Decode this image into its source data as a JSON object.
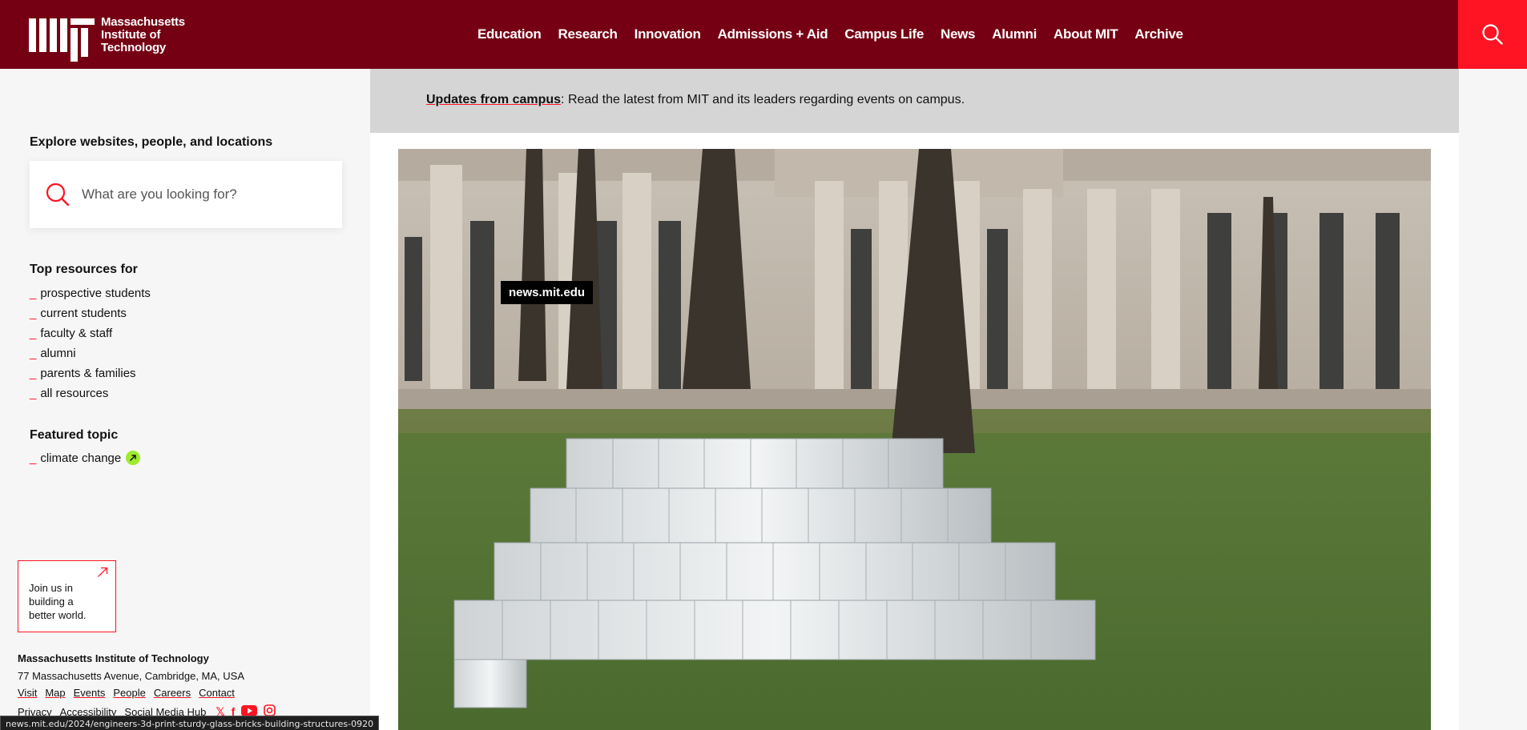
{
  "header": {
    "logo_lines": [
      "Massachusetts",
      "Institute of",
      "Technology"
    ],
    "nav": [
      "Education",
      "Research",
      "Innovation",
      "Admissions + Aid",
      "Campus Life",
      "News",
      "Alumni",
      "About MIT",
      "Archive"
    ]
  },
  "banner": {
    "link_text": "Updates from campus",
    "text": ": Read the latest from MIT and its leaders regarding events on campus."
  },
  "sidebar": {
    "explore_title": "Explore websites, people, and locations",
    "search_placeholder": "What are you looking for?",
    "top_resources_title": "Top resources for",
    "resources": [
      "prospective students",
      "current students",
      "faculty & staff",
      "alumni",
      "parents & families",
      "all resources"
    ],
    "featured_title": "Featured topic",
    "featured_item": "climate change",
    "join_lines": [
      "Join us in",
      "building a",
      "better world."
    ]
  },
  "footer": {
    "name": "Massachusetts Institute of Technology",
    "address": "77 Massachusetts Avenue, Cambridge, MA, USA",
    "links": [
      "Visit",
      "Map",
      "Events",
      "People",
      "Careers",
      "Contact"
    ],
    "links2": [
      "Privacy",
      "Accessibility",
      "Social Media Hub"
    ],
    "social_icons": [
      "x-icon",
      "facebook-icon",
      "youtube-icon",
      "instagram-icon"
    ]
  },
  "hero": {
    "tag": "news.mit.edu"
  },
  "status_bar": {
    "url": "news.mit.edu/2024/engineers-3d-print-sturdy-glass-bricks-building-structures-0920"
  },
  "colors": {
    "mit_red": "#750014",
    "bright_red": "#ff1423",
    "accent_green": "#9eeb2c"
  }
}
